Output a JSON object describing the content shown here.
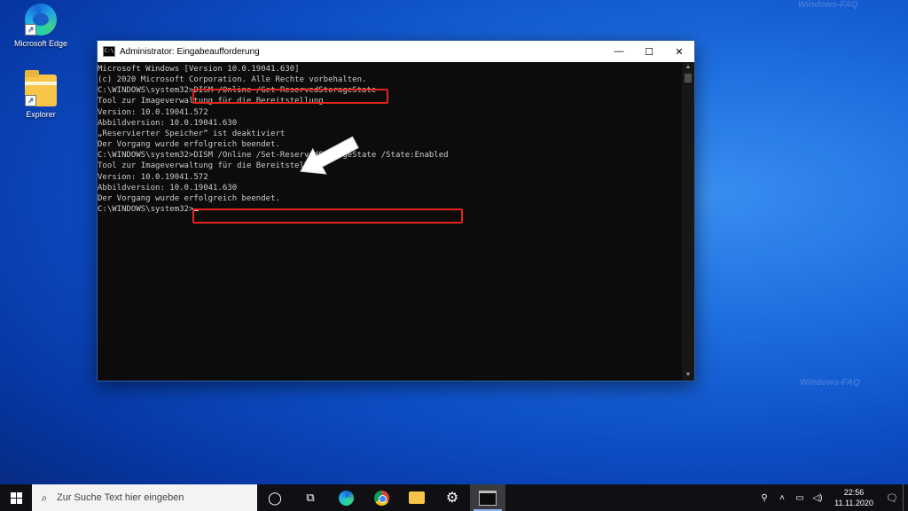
{
  "desktop": {
    "icons": [
      {
        "label": "Microsoft Edge"
      },
      {
        "label": "Explorer"
      }
    ],
    "watermark": "Windows-FAQ"
  },
  "window": {
    "title": "Administrator: Eingabeaufforderung",
    "icon_text": "C:\\",
    "controls": {
      "minimize": "—",
      "maximize": "☐",
      "close": "✕"
    },
    "console_lines": [
      "Microsoft Windows [Version 10.0.19041.630]",
      "(c) 2020 Microsoft Corporation. Alle Rechte vorbehalten.",
      "",
      "C:\\WINDOWS\\system32>DISM /Online /Get-ReservedStorageState",
      "",
      "Tool zur Imageverwaltung für die Bereitstellung",
      "Version: 10.0.19041.572",
      "",
      "Abbildversion: 10.0.19041.630",
      "",
      "„Reservierter Speicher“ ist deaktiviert",
      "",
      "Der Vorgang wurde erfolgreich beendet.",
      "",
      "C:\\WINDOWS\\system32>DISM /Online /Set-ReservedStorageState /State:Enabled",
      "",
      "Tool zur Imageverwaltung für die Bereitstellung",
      "Version: 10.0.19041.572",
      "",
      "Abbildversion: 10.0.19041.630",
      "",
      "Der Vorgang wurde erfolgreich beendet.",
      "",
      "C:\\WINDOWS\\system32>"
    ],
    "colors": {
      "console_bg": "#0c0c0c",
      "console_text": "#cccccc",
      "highlight": "#e0251f"
    }
  },
  "taskbar": {
    "search_placeholder": "Zur Suche Text hier eingeben",
    "icons": [
      "start-icon",
      "cortana-icon",
      "task-view-icon",
      "edge-icon",
      "chrome-icon",
      "explorer-icon",
      "settings-icon",
      "cmd-icon"
    ],
    "clock_time": "22:56",
    "clock_date": "11.11.2020"
  }
}
